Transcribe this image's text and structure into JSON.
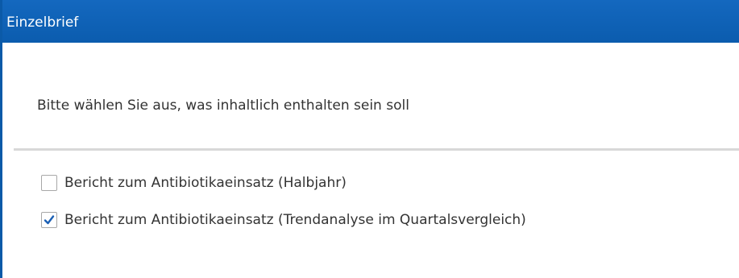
{
  "dialog": {
    "title": "Einzelbrief",
    "prompt": "Bitte wählen Sie aus, was inhaltlich enthalten sein soll",
    "options": [
      {
        "label": "Bericht zum Antibiotikaeinsatz (Halbjahr)",
        "checked": false
      },
      {
        "label": "Bericht zum Antibiotikaeinsatz (Trendanalyse im Quartalsvergleich)",
        "checked": true
      }
    ]
  },
  "colors": {
    "titlebar": "#0b5cae",
    "checkmark": "#1a5fb4",
    "text": "#333333",
    "divider": "#d8d8d8"
  }
}
